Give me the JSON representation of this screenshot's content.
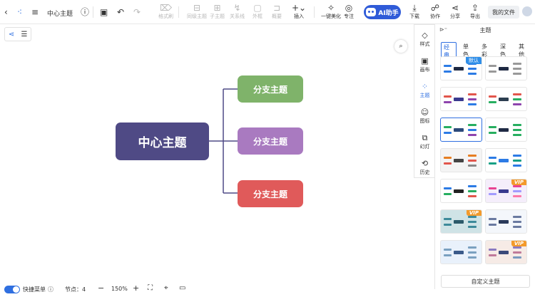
{
  "toolbar": {
    "doc_title": "中心主题",
    "items": [
      {
        "name": "style-brush",
        "label": "格式刷",
        "icon": "⌦"
      },
      {
        "name": "sibling-topic",
        "label": "同级主题",
        "icon": "⊟"
      },
      {
        "name": "child-topic",
        "label": "子主题",
        "icon": "⊞"
      },
      {
        "name": "relation",
        "label": "关系线",
        "icon": "↯"
      },
      {
        "name": "outline-frame",
        "label": "外框",
        "icon": "▢"
      },
      {
        "name": "summary",
        "label": "概要",
        "icon": "⊐"
      },
      {
        "name": "insert",
        "label": "插入",
        "icon": "+⌄"
      },
      {
        "name": "beautify",
        "label": "一键美化",
        "icon": "✧"
      },
      {
        "name": "focus",
        "label": "专注",
        "icon": "◎"
      },
      {
        "name": "download",
        "label": "下载",
        "icon": "⤓"
      },
      {
        "name": "collaborate",
        "label": "协作",
        "icon": "☍"
      },
      {
        "name": "share",
        "label": "分享",
        "icon": "⋖"
      },
      {
        "name": "export",
        "label": "导出",
        "icon": "⇪"
      }
    ],
    "ai_label": "AI助手",
    "my_files": "我的文件"
  },
  "mindmap": {
    "center": {
      "label": "中心主题",
      "color": "#4f4a85"
    },
    "branches": [
      {
        "label": "分支主题",
        "color": "#7fb36a"
      },
      {
        "label": "分支主题",
        "color": "#a97ac0"
      },
      {
        "label": "分支主题",
        "color": "#e05a5a"
      }
    ],
    "line_color": "#4f4a85"
  },
  "sidebar": {
    "tabs": [
      {
        "label": "样式",
        "icon": "◇"
      },
      {
        "label": "画布",
        "icon": "▣"
      },
      {
        "label": "主题",
        "icon": "⁘"
      },
      {
        "label": "图标",
        "icon": "☺"
      },
      {
        "label": "幻灯",
        "icon": "⧉"
      },
      {
        "label": "历史",
        "icon": "⟲"
      }
    ],
    "active_tab": "主题"
  },
  "panel": {
    "title": "主题",
    "theme_tabs": [
      "经典",
      "单色",
      "多彩",
      "深色",
      "其他"
    ],
    "badge_default": "默认",
    "badge_vip": "VIP",
    "custom_button": "自定义主题"
  },
  "bottom": {
    "quick_menu": "快捷菜单",
    "nodes_label": "节点：",
    "nodes_count": "4",
    "zoom": "150%"
  }
}
